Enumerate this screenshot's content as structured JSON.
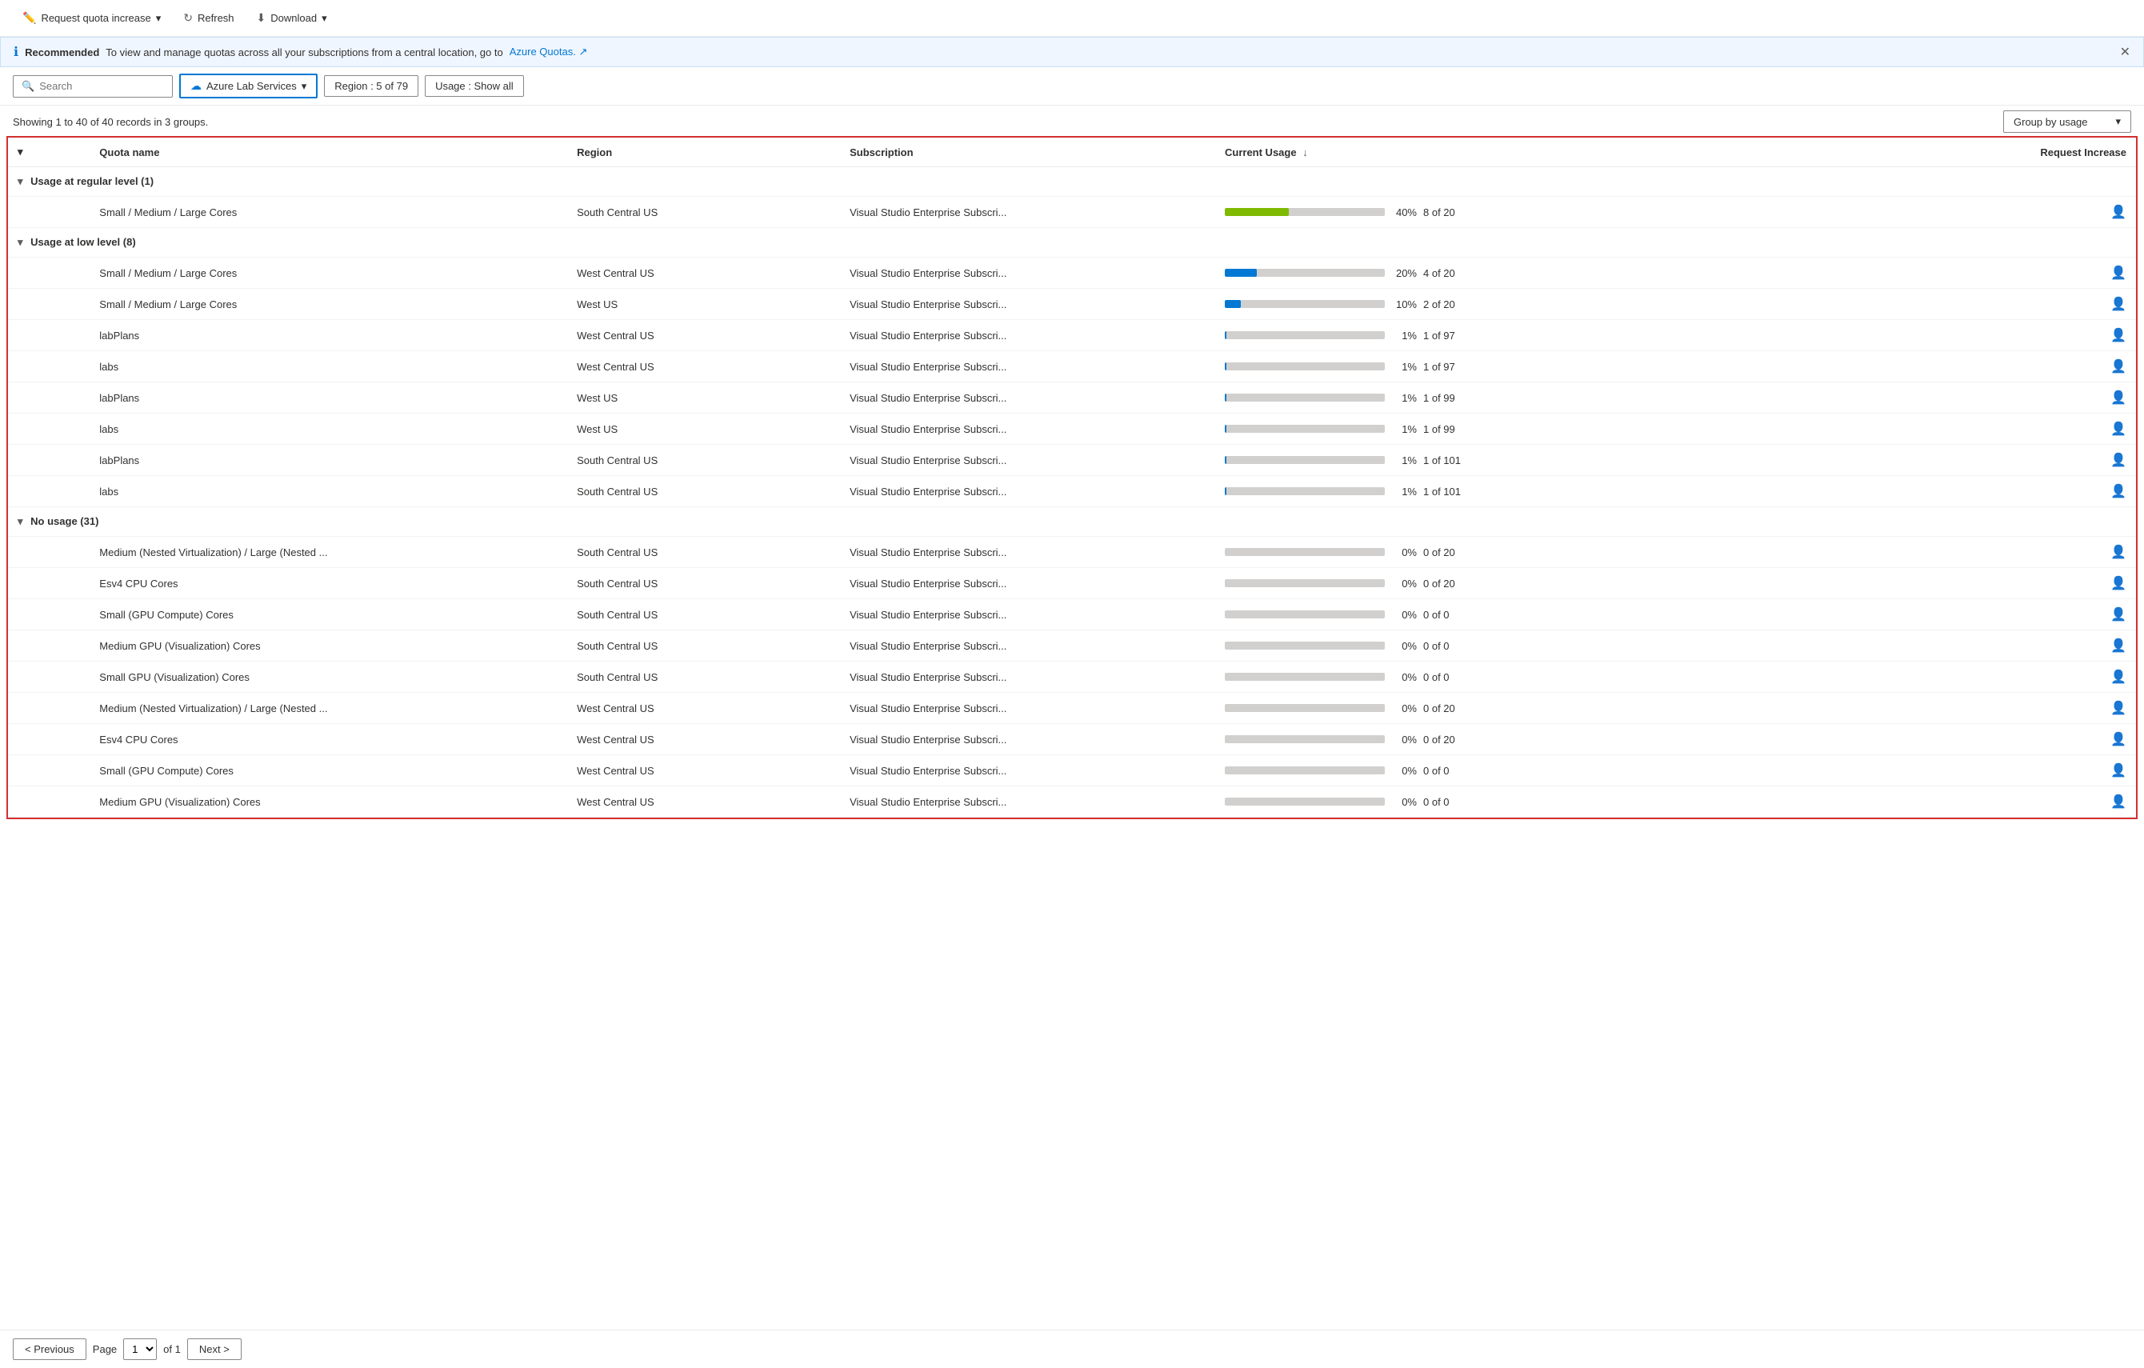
{
  "toolbar": {
    "request_quota_label": "Request quota increase",
    "refresh_label": "Refresh",
    "download_label": "Download"
  },
  "banner": {
    "badge": "Recommended",
    "text": "To view and manage quotas across all your subscriptions from a central location, go to",
    "link_text": "Azure Quotas.",
    "link_icon": "↗"
  },
  "filters": {
    "search_placeholder": "Search",
    "service_label": "Azure Lab Services",
    "region_label": "Region : 5 of 79",
    "usage_label": "Usage : Show all"
  },
  "record_info": {
    "text": "Showing 1 to 40 of 40 records in 3 groups.",
    "group_by_label": "Group by usage"
  },
  "columns": {
    "quota_name": "Quota name",
    "region": "Region",
    "subscription": "Subscription",
    "current_usage": "Current Usage",
    "request_increase": "Request Increase"
  },
  "groups": [
    {
      "label": "Usage at regular level (1)",
      "rows": [
        {
          "quota_name": "Small / Medium / Large Cores",
          "region": "South Central US",
          "subscription": "Visual Studio Enterprise Subscri...",
          "usage_pct": 40,
          "usage_count": "8 of 20",
          "bar_color": "#7FBA00"
        }
      ]
    },
    {
      "label": "Usage at low level (8)",
      "rows": [
        {
          "quota_name": "Small / Medium / Large Cores",
          "region": "West Central US",
          "subscription": "Visual Studio Enterprise Subscri...",
          "usage_pct": 20,
          "usage_count": "4 of 20",
          "bar_color": "#0078d4"
        },
        {
          "quota_name": "Small / Medium / Large Cores",
          "region": "West US",
          "subscription": "Visual Studio Enterprise Subscri...",
          "usage_pct": 10,
          "usage_count": "2 of 20",
          "bar_color": "#0078d4"
        },
        {
          "quota_name": "labPlans",
          "region": "West Central US",
          "subscription": "Visual Studio Enterprise Subscri...",
          "usage_pct": 1,
          "usage_count": "1 of 97",
          "bar_color": "#0078d4"
        },
        {
          "quota_name": "labs",
          "region": "West Central US",
          "subscription": "Visual Studio Enterprise Subscri...",
          "usage_pct": 1,
          "usage_count": "1 of 97",
          "bar_color": "#0078d4"
        },
        {
          "quota_name": "labPlans",
          "region": "West US",
          "subscription": "Visual Studio Enterprise Subscri...",
          "usage_pct": 1,
          "usage_count": "1 of 99",
          "bar_color": "#0078d4"
        },
        {
          "quota_name": "labs",
          "region": "West US",
          "subscription": "Visual Studio Enterprise Subscri...",
          "usage_pct": 1,
          "usage_count": "1 of 99",
          "bar_color": "#0078d4"
        },
        {
          "quota_name": "labPlans",
          "region": "South Central US",
          "subscription": "Visual Studio Enterprise Subscri...",
          "usage_pct": 1,
          "usage_count": "1 of 101",
          "bar_color": "#0078d4"
        },
        {
          "quota_name": "labs",
          "region": "South Central US",
          "subscription": "Visual Studio Enterprise Subscri...",
          "usage_pct": 1,
          "usage_count": "1 of 101",
          "bar_color": "#0078d4"
        }
      ]
    },
    {
      "label": "No usage (31)",
      "rows": [
        {
          "quota_name": "Medium (Nested Virtualization) / Large (Nested ...",
          "region": "South Central US",
          "subscription": "Visual Studio Enterprise Subscri...",
          "usage_pct": 0,
          "usage_count": "0 of 20",
          "bar_color": "#d2d0ce"
        },
        {
          "quota_name": "Esv4 CPU Cores",
          "region": "South Central US",
          "subscription": "Visual Studio Enterprise Subscri...",
          "usage_pct": 0,
          "usage_count": "0 of 20",
          "bar_color": "#d2d0ce"
        },
        {
          "quota_name": "Small (GPU Compute) Cores",
          "region": "South Central US",
          "subscription": "Visual Studio Enterprise Subscri...",
          "usage_pct": 0,
          "usage_count": "0 of 0",
          "bar_color": "#d2d0ce"
        },
        {
          "quota_name": "Medium GPU (Visualization) Cores",
          "region": "South Central US",
          "subscription": "Visual Studio Enterprise Subscri...",
          "usage_pct": 0,
          "usage_count": "0 of 0",
          "bar_color": "#d2d0ce"
        },
        {
          "quota_name": "Small GPU (Visualization) Cores",
          "region": "South Central US",
          "subscription": "Visual Studio Enterprise Subscri...",
          "usage_pct": 0,
          "usage_count": "0 of 0",
          "bar_color": "#d2d0ce"
        },
        {
          "quota_name": "Medium (Nested Virtualization) / Large (Nested ...",
          "region": "West Central US",
          "subscription": "Visual Studio Enterprise Subscri...",
          "usage_pct": 0,
          "usage_count": "0 of 20",
          "bar_color": "#d2d0ce"
        },
        {
          "quota_name": "Esv4 CPU Cores",
          "region": "West Central US",
          "subscription": "Visual Studio Enterprise Subscri...",
          "usage_pct": 0,
          "usage_count": "0 of 20",
          "bar_color": "#d2d0ce"
        },
        {
          "quota_name": "Small (GPU Compute) Cores",
          "region": "West Central US",
          "subscription": "Visual Studio Enterprise Subscri...",
          "usage_pct": 0,
          "usage_count": "0 of 0",
          "bar_color": "#d2d0ce"
        },
        {
          "quota_name": "Medium GPU (Visualization) Cores",
          "region": "West Central US",
          "subscription": "Visual Studio Enterprise Subscri...",
          "usage_pct": 0,
          "usage_count": "0 of 0",
          "bar_color": "#d2d0ce"
        }
      ]
    }
  ],
  "pagination": {
    "previous_label": "< Previous",
    "next_label": "Next >",
    "page_label": "Page",
    "current_page": "1",
    "of_label": "of 1"
  }
}
